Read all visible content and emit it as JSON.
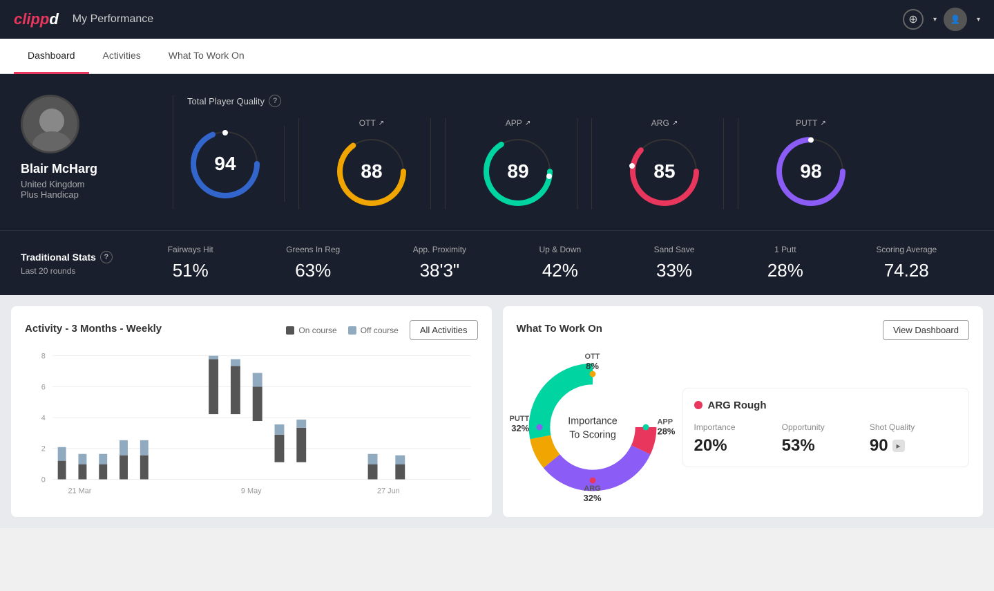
{
  "app": {
    "logo": "clippd",
    "nav_title": "My Performance"
  },
  "tabs": [
    {
      "label": "Dashboard",
      "active": true
    },
    {
      "label": "Activities",
      "active": false
    },
    {
      "label": "What To Work On",
      "active": false
    }
  ],
  "player": {
    "name": "Blair McHarg",
    "country": "United Kingdom",
    "handicap": "Plus Handicap"
  },
  "total_quality": {
    "label": "Total Player Quality",
    "value": 94
  },
  "scores": [
    {
      "label": "OTT",
      "value": 88,
      "color_start": "#f0a500",
      "color_end": "#f0a500",
      "bg": "#2a2f3e"
    },
    {
      "label": "APP",
      "value": 89,
      "color_start": "#00d4a0",
      "color_end": "#00d4a0",
      "bg": "#2a2f3e"
    },
    {
      "label": "ARG",
      "value": 85,
      "color_start": "#e8365d",
      "color_end": "#e8365d",
      "bg": "#2a2f3e"
    },
    {
      "label": "PUTT",
      "value": 98,
      "color_start": "#8b5cf6",
      "color_end": "#8b5cf6",
      "bg": "#2a2f3e"
    }
  ],
  "traditional_stats": {
    "title": "Traditional Stats",
    "subtitle": "Last 20 rounds",
    "items": [
      {
        "name": "Fairways Hit",
        "value": "51%"
      },
      {
        "name": "Greens In Reg",
        "value": "63%"
      },
      {
        "name": "App. Proximity",
        "value": "38'3\""
      },
      {
        "name": "Up & Down",
        "value": "42%"
      },
      {
        "name": "Sand Save",
        "value": "33%"
      },
      {
        "name": "1 Putt",
        "value": "28%"
      },
      {
        "name": "Scoring Average",
        "value": "74.28"
      }
    ]
  },
  "activity_chart": {
    "title": "Activity - 3 Months - Weekly",
    "legend": [
      {
        "label": "On course",
        "color": "#555"
      },
      {
        "label": "Off course",
        "color": "#90aac0"
      }
    ],
    "all_activities_btn": "All Activities",
    "x_labels": [
      "21 Mar",
      "9 May",
      "27 Jun"
    ],
    "y_labels": [
      "0",
      "2",
      "4",
      "6",
      "8"
    ]
  },
  "what_to_work_on": {
    "title": "What To Work On",
    "view_btn": "View Dashboard",
    "donut_center": [
      "Importance",
      "To Scoring"
    ],
    "segments": [
      {
        "label": "OTT",
        "percent": "8%",
        "color": "#f0a500"
      },
      {
        "label": "APP",
        "percent": "28%",
        "color": "#00d4a0"
      },
      {
        "label": "ARG",
        "percent": "32%",
        "color": "#e8365d"
      },
      {
        "label": "PUTT",
        "percent": "32%",
        "color": "#8b5cf6"
      }
    ],
    "card": {
      "title": "ARG Rough",
      "dot_color": "#e8365d",
      "metrics": [
        {
          "name": "Importance",
          "value": "20%"
        },
        {
          "name": "Opportunity",
          "value": "53%"
        },
        {
          "name": "Shot Quality",
          "value": "90",
          "badge": ""
        }
      ]
    }
  }
}
